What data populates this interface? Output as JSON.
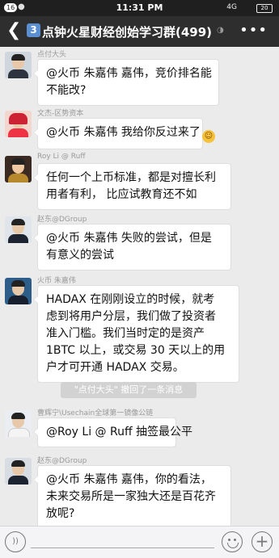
{
  "status_bar": {
    "notification_count": "16",
    "time": "11:31 PM",
    "signal_text": "4G",
    "battery": "20"
  },
  "header": {
    "back_icon": "chevron-left-icon",
    "unread_badge": "3",
    "title": "点钟火星财经创始学习群(499)",
    "mute_icon": "mute-icon",
    "more_icon": "more-dots-icon"
  },
  "messages": [
    {
      "sender": "点付大头",
      "lines": [
        "@火币 朱嘉伟  嘉伟，竞价排名能",
        "不能改?"
      ]
    },
    {
      "sender": "文杰-区势资本",
      "lines": [
        "@火币 朱嘉伟  我给你反过来了"
      ],
      "emoji": "😜"
    },
    {
      "sender": "Roy Li @ Ruff",
      "lines": [
        "任何一个上币标准，都是对擅长利",
        "用者有利， 比应试教育还不如"
      ]
    },
    {
      "sender": "赵东@DGroup",
      "lines": [
        "@火币 朱嘉伟  失败的尝试，但是",
        "有意义的尝试"
      ]
    },
    {
      "sender": "火币 朱嘉伟",
      "lines": [
        "HADAX 在刚刚设立的时候，就考",
        "虑到将用户分层，我们做了投资者",
        "准入门槛。我们当时定的是资产",
        "1BTC 以上，或交易 30 天以上的用",
        "户才可开通 HADAX 交易。"
      ]
    },
    {
      "sender": "曹辉宁\\Usechain全球第一镜像公链",
      "lines": [
        "@Roy Li @ Ruff  抽签最公平"
      ]
    },
    {
      "sender": "赵东@DGroup",
      "lines": [
        "@火币 朱嘉伟  嘉伟，你的看法，",
        "未来交易所是一家独大还是百花齐",
        "放呢?"
      ]
    }
  ],
  "system_note": "\"点付大头\" 撤回了一条消息",
  "input_bar": {
    "voice_icon": "voice-icon",
    "emoji_icon": "emoji-icon",
    "plus_icon": "plus-icon"
  }
}
